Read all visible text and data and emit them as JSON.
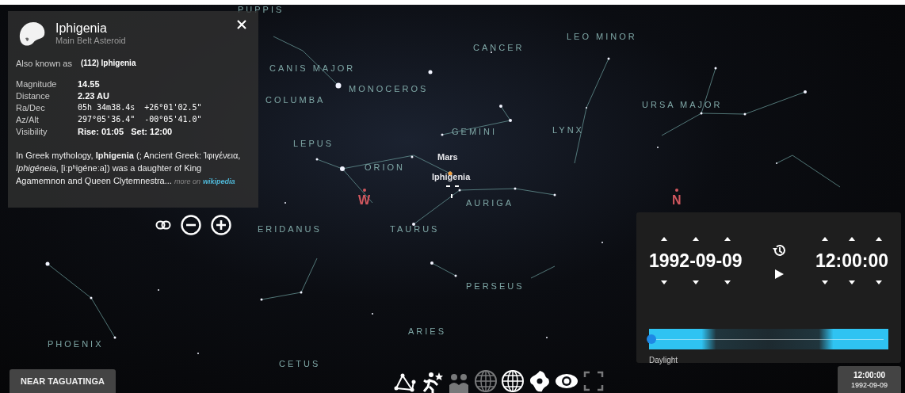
{
  "info_panel": {
    "title": "Iphigenia",
    "subtitle": "Main Belt Asteroid",
    "also_known_as": {
      "label": "Also known as",
      "value": "(112) Iphigenia"
    },
    "properties": [
      {
        "label": "Magnitude",
        "value": "14.55",
        "kind": "text"
      },
      {
        "label": "Distance",
        "value": "2.23 AU",
        "kind": "text"
      },
      {
        "label": "Ra/Dec",
        "value": "05h 34m38.4s  +26°01'02.5\"",
        "kind": "mono"
      },
      {
        "label": "Az/Alt",
        "value": "297°05'36.4\"  -00°05'41.0\"",
        "kind": "mono"
      },
      {
        "label": "Visibility",
        "value": "Rise: 01:05   Set: 12:00",
        "kind": "text"
      }
    ],
    "description": "In Greek mythology, **Iphigenia** (; Ancient Greek: Ἰφιγένεια, *Iphigéneia*, [iːpʰiɡéneːa]) was a daughter of King Agamemnon and Queen Clytemnestra...",
    "more_label": "more on",
    "more_link": "wikipedia"
  },
  "sky_labels": [
    {
      "text": "PUPPIS",
      "kind": "constellation"
    },
    {
      "text": "CANIS MAJOR",
      "kind": "constellation"
    },
    {
      "text": "MONOCEROS",
      "kind": "constellation"
    },
    {
      "text": "CANCER",
      "kind": "constellation"
    },
    {
      "text": "LEO MINOR",
      "kind": "constellation"
    },
    {
      "text": "COLUMBA",
      "kind": "constellation"
    },
    {
      "text": "URSA MAJOR",
      "kind": "constellation"
    },
    {
      "text": "GEMINI",
      "kind": "constellation"
    },
    {
      "text": "LYNX",
      "kind": "constellation"
    },
    {
      "text": "LEPUS",
      "kind": "constellation"
    },
    {
      "text": "ORION",
      "kind": "constellation"
    },
    {
      "text": "Mars",
      "kind": "object"
    },
    {
      "text": "Iphigenia",
      "kind": "object"
    },
    {
      "text": "W",
      "kind": "cardinal"
    },
    {
      "text": "AURIGA",
      "kind": "constellation"
    },
    {
      "text": "N",
      "kind": "cardinal"
    },
    {
      "text": "ERIDANUS",
      "kind": "constellation"
    },
    {
      "text": "TAURUS",
      "kind": "constellation"
    },
    {
      "text": "PERSEUS",
      "kind": "constellation"
    },
    {
      "text": "ARIES",
      "kind": "constellation"
    },
    {
      "text": "PHOENIX",
      "kind": "constellation"
    },
    {
      "text": "CETUS",
      "kind": "constellation"
    }
  ],
  "location": "NEAR TAGUATINGA",
  "toolbar": [
    {
      "kind": "constellation-lines",
      "on": true
    },
    {
      "kind": "atmosphere",
      "on": true
    },
    {
      "kind": "landscape",
      "on": false
    },
    {
      "kind": "azimuthal-grid",
      "on": false
    },
    {
      "kind": "equatorial-grid",
      "on": true
    },
    {
      "kind": "deep-sky",
      "on": true
    },
    {
      "kind": "view",
      "on": true
    },
    {
      "kind": "fullscreen",
      "on": false
    }
  ],
  "time_panel": {
    "date": "1992-09-09",
    "time": "12:00:00",
    "slider": {
      "level": 0.01
    },
    "slider_label": "Daylight"
  },
  "clock": {
    "time": "12:00:00",
    "date": "1992-09-09"
  }
}
